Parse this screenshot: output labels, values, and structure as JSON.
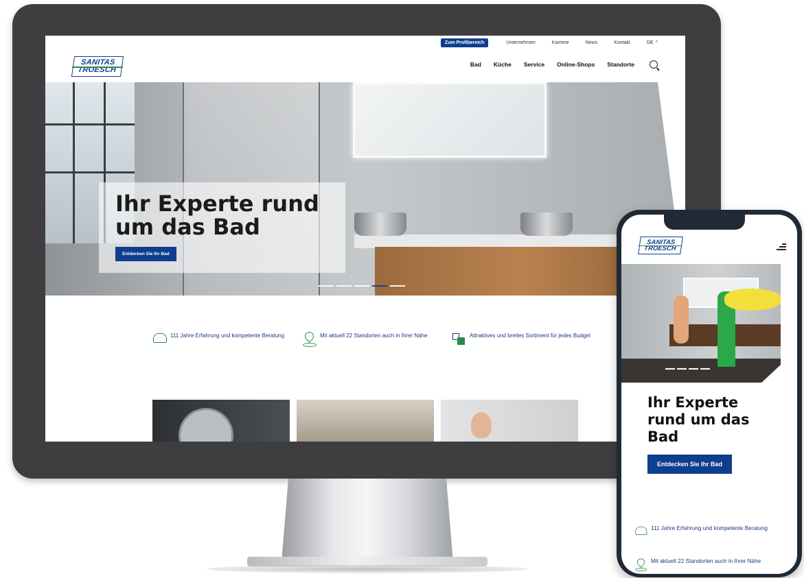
{
  "desktop": {
    "topbar": {
      "pro_button": "Zum Profibereich",
      "links": [
        "Unternehmen",
        "Karriere",
        "News",
        "Kontakt"
      ],
      "language": "DE",
      "language_chevron": "^"
    },
    "header": {
      "logo_line1": "SANITAS",
      "logo_line2": "TROESCH",
      "nav": [
        "Bad",
        "Küche",
        "Service",
        "Online-Shops",
        "Standorte"
      ]
    },
    "hero": {
      "title": "Ihr Experte rund um das Bad",
      "button": "Entdecken Sie Ihr Bad",
      "slide_count": 5,
      "active_slide": 4
    },
    "features": [
      {
        "icon": "people-icon",
        "text": "111 Jahre Erfahrung und kompetente Beratung"
      },
      {
        "icon": "location-pin-icon",
        "text": "Mit aktuell 22 Standorten auch in Ihrer Nähe"
      },
      {
        "icon": "tiles-icon",
        "text": "Attraktives und breites Sortiment für jedes Budget"
      }
    ]
  },
  "mobile": {
    "logo_line1": "SANITAS",
    "logo_line2": "TROESCH",
    "hero_title": "Ihr Experte rund um das Bad",
    "button": "Entdecken Sie Ihr Bad",
    "features": [
      {
        "icon": "people-icon",
        "text": "111 Jahre Erfahrung und kompetente Beratung"
      },
      {
        "icon": "location-pin-icon",
        "text": "Mit aktuell 22 Standorten auch in Ihrer Nähe"
      }
    ]
  },
  "colors": {
    "brand_blue": "#0e3e8e",
    "brand_green": "#2a8a4a",
    "monitor_bezel": "#3e3e40"
  }
}
